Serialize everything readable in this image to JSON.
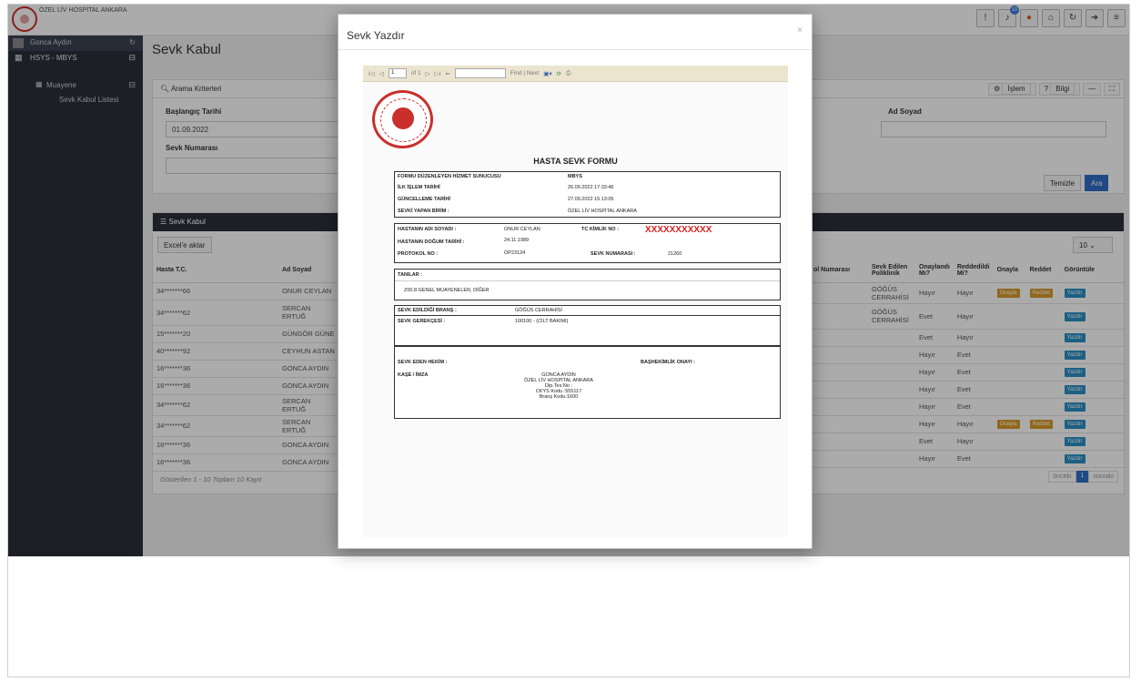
{
  "header": {
    "hospital": "ÖZEL LİV HOSPİTAL ANKARA",
    "notif_count": "10"
  },
  "sidebar": {
    "user": "Gonca Aydın",
    "module": "HSYS - MBYS",
    "section": "Muayene",
    "leaf": "Sevk Kabul Listesi"
  },
  "page": {
    "title": "Sevk Kabul"
  },
  "search": {
    "title": "Arama Kriterleri",
    "islem": "İşlem",
    "bilgi": "Bilgi",
    "start_label": "Başlangıç Tarihi",
    "start_value": "01.09.2022",
    "name_label": "Ad Soyad",
    "sevkno_label": "Sevk Numarası",
    "clear": "Temizle",
    "search": "Ara"
  },
  "list": {
    "title": "Sevk Kabul",
    "export": "Excel'e aktar",
    "page_size": "10",
    "footer": "Gösterilen 1 - 10 Toplam 10 Kayıt",
    "prev": "önceki",
    "page": "1",
    "next": "sonraki",
    "cols": {
      "tc": "Hasta T.C.",
      "name": "Ad Soyad",
      "proto": "ol Numarası",
      "poli": "Sevk Edilen Poliklinik",
      "onay": "Onaylandı Mı?",
      "red": "Reddedildi Mi?",
      "onayla": "Onayla",
      "reddet": "Reddet",
      "gor": "Görüntüle"
    },
    "rows": [
      {
        "tc": "34*******66",
        "name": "ONUR CEYLAN",
        "poli": "GÖĞÜS CERRAHİSİ",
        "onay": "Hayır",
        "red": "Hayır",
        "a": "Onayla",
        "r": "Reddet",
        "g": "Yazdır"
      },
      {
        "tc": "34*******62",
        "name": "SERCAN ERTUĞ",
        "poli": "GÖĞÜS CERRAHİSİ",
        "onay": "Evet",
        "red": "Hayır",
        "a": "",
        "r": "",
        "g": "Yazdır"
      },
      {
        "tc": "15*******20",
        "name": "GÜNGÖR GÜNE",
        "poli": "",
        "onay": "Evet",
        "red": "Hayır",
        "a": "",
        "r": "",
        "g": "Yazdır"
      },
      {
        "tc": "40*******92",
        "name": "CEYHUN ASTAN",
        "poli": "",
        "onay": "Hayır",
        "red": "Evet",
        "a": "",
        "r": "",
        "g": "Yazdır"
      },
      {
        "tc": "16*******36",
        "name": "GONCA AYDIN",
        "poli": "",
        "onay": "Hayır",
        "red": "Evet",
        "a": "",
        "r": "",
        "g": "Yazdır"
      },
      {
        "tc": "16*******36",
        "name": "GONCA AYDIN",
        "poli": "",
        "onay": "Hayır",
        "red": "Evet",
        "a": "",
        "r": "",
        "g": "Yazdır"
      },
      {
        "tc": "34*******62",
        "name": "SERCAN ERTUĞ",
        "poli": "",
        "onay": "Hayır",
        "red": "Evet",
        "a": "",
        "r": "",
        "g": "Yazdır"
      },
      {
        "tc": "34*******62",
        "name": "SERCAN ERTUĞ",
        "poli": "",
        "onay": "Hayır",
        "red": "Hayır",
        "a": "Onayla",
        "r": "Reddet",
        "g": "Yazdır"
      },
      {
        "tc": "16*******36",
        "name": "GONCA AYDIN",
        "poli": "",
        "onay": "Evet",
        "red": "Hayır",
        "a": "",
        "r": "",
        "g": "Yazdır"
      },
      {
        "tc": "16*******36",
        "name": "GONCA AYDIN",
        "poli": "",
        "onay": "Hayır",
        "red": "Evet",
        "a": "",
        "r": "",
        "g": "Yazdır"
      }
    ]
  },
  "modal": {
    "title": "Sevk Yazdır",
    "close": "×",
    "toolbar": {
      "first": "I◁",
      "prev": "◁",
      "page": "1",
      "of": "of 1",
      "next": "▷",
      "last": "▷I",
      "back": "⇐",
      "find_next": "Find | Next"
    },
    "form": {
      "title": "HASTA SEVK FORMU",
      "l1": "FORMU DÜZENLEYEN HİZMET SUNUCUSU",
      "v1": "MBYS",
      "l2": "İLK İŞLEM TARİHİ",
      "v2": "26.09.2022 17:33:46",
      "l3": "GÜNCELLEME TARİHİ",
      "v3": "27.09.2022 15:13:05",
      "l4": "SEVKİ YAPAN BİRİM :",
      "v4": "ÖZEL LİV HOSPİTAL ANKARA",
      "pname_l": "HASTANIN ADI SOYADI :",
      "pname_v": "ONUR CEYLAN",
      "tc_l": "TC KİMLİK NO :",
      "tc_v": "XXXXXXXXXXX",
      "dob_l": "HASTANIN DOĞUM TARİHİ :",
      "dob_v": "24.11.1989",
      "proto_l": "PROTOKOL NO :",
      "proto_v": "OP23124",
      "sevkno_l": "SEVK NUMARASI :",
      "sevkno_v": "21260",
      "tani_l": "TANILAR :",
      "tani_v": "Z00.8 GENEL MUAYENELER, DİĞER",
      "brans_l": "SEVK EDİLDİĞİ BRANŞ :",
      "brans_v": "GÖĞÜS CERRAHİSİ",
      "ger_l": "SEVK GEREKÇESİ :",
      "ger_v": "100100 - (CİLT BAKIMI)",
      "hekim_l": "SEVK EDEN HEKİM :",
      "bas_l": "BAŞHEKİMLİK ONAYI :",
      "kase_l": "KAŞE / İMZA",
      "doc1": "GONCA AYDIN",
      "doc2": "ÖZEL LİV HOSPİTAL ANKARA",
      "doc3": "Dip.Tes.No :",
      "doc4": "CKYS Kodu :555117",
      "doc5": "Branş Kodu:1600"
    }
  }
}
